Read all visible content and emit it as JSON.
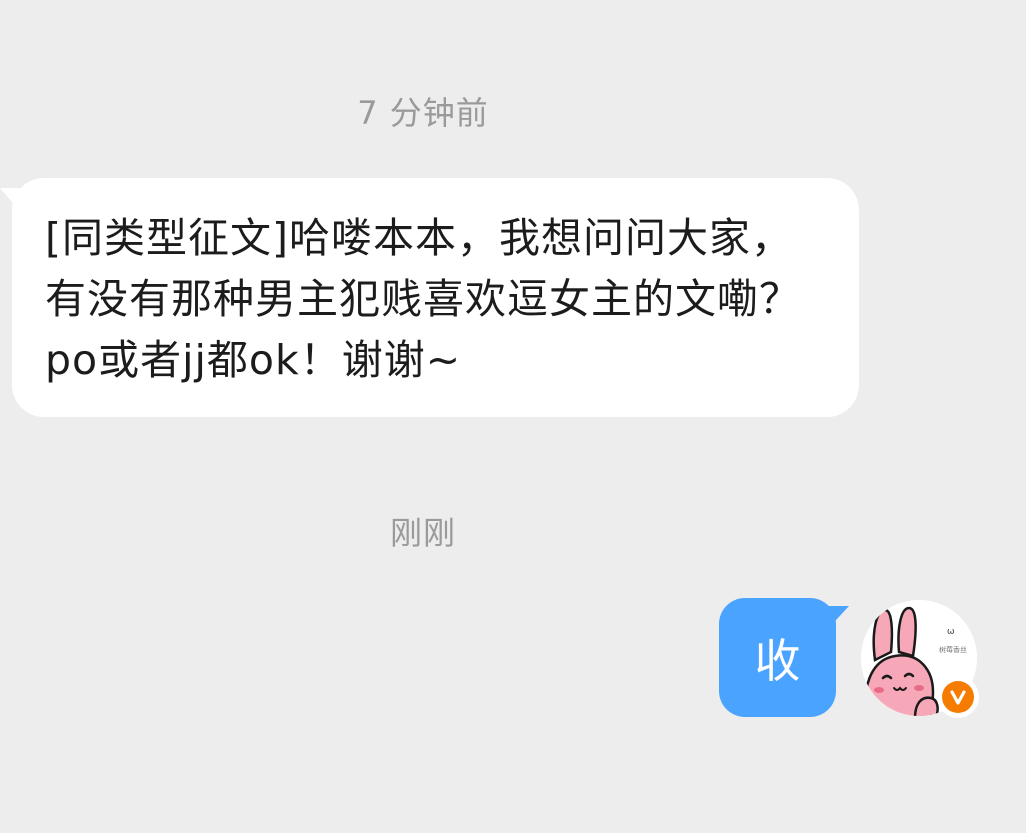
{
  "timestamps": {
    "first": "7 分钟前",
    "second": "刚刚"
  },
  "incoming_message": {
    "text": "[同类型征文]哈喽本本，我想问问大家，有没有那种男主犯贱喜欢逗女主的文嘞？po或者jj都ok！谢谢~"
  },
  "outgoing_message": {
    "text": "收"
  },
  "avatar": {
    "icon": "pink-bunny-avatar",
    "badge_icon": "verified-v-badge-icon",
    "badge_color": "#f57c00",
    "caption": "树莓香丝"
  },
  "colors": {
    "background": "#ededed",
    "incoming_bubble": "#ffffff",
    "outgoing_bubble": "#4aa4ff"
  }
}
